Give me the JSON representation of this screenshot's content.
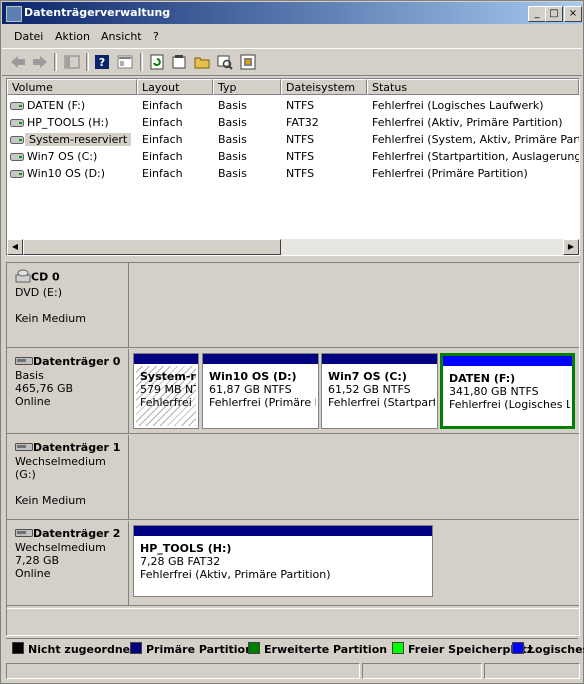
{
  "window": {
    "title": "Datenträgerverwaltung",
    "minimize": "_",
    "maximize": "□",
    "close": "×"
  },
  "menu": [
    {
      "label": "Datei",
      "accel": "D"
    },
    {
      "label": "Aktion",
      "accel": "k"
    },
    {
      "label": "Ansicht",
      "accel": "A"
    },
    {
      "label": "?",
      "accel": "?"
    }
  ],
  "toolbar": {
    "icons": [
      "back-icon",
      "forward-icon",
      "show-hide-tree-icon",
      "help-icon",
      "console-tree-icon",
      "refresh-icon",
      "properties-icon",
      "open-folder-icon",
      "rescan-icon",
      "settings-icon"
    ]
  },
  "volume_table": {
    "columns": [
      "Volume",
      "Layout",
      "Typ",
      "Dateisystem",
      "Status"
    ],
    "rows": [
      {
        "volume": "DATEN (F:)",
        "layout": "Einfach",
        "typ": "Basis",
        "fs": "NTFS",
        "status": "Fehlerfrei (Logisches Laufwerk)"
      },
      {
        "volume": "HP_TOOLS (H:)",
        "layout": "Einfach",
        "typ": "Basis",
        "fs": "FAT32",
        "status": "Fehlerfrei (Aktiv, Primäre Partition)"
      },
      {
        "volume": "System-reserviert",
        "layout": "Einfach",
        "typ": "Basis",
        "fs": "NTFS",
        "status": "Fehlerfrei (System, Aktiv, Primäre Partition)"
      },
      {
        "volume": "Win7 OS (C:)",
        "layout": "Einfach",
        "typ": "Basis",
        "fs": "NTFS",
        "status": "Fehlerfrei (Startpartition, Auslagerungsdatei"
      },
      {
        "volume": "Win10 OS (D:)",
        "layout": "Einfach",
        "typ": "Basis",
        "fs": "NTFS",
        "status": "Fehlerfrei (Primäre Partition)"
      }
    ],
    "selected_row": 2
  },
  "disks": [
    {
      "name": "CD 0",
      "line1": "DVD (E:)",
      "line2": "",
      "line3": "Kein Medium",
      "icon": "cd-drive-icon",
      "partitions": []
    },
    {
      "name": "Datenträger 0",
      "line1": "Basis",
      "line2": "465,76 GB",
      "line3": "Online",
      "icon": "hard-disk-icon",
      "partitions": [
        {
          "title": "System-r",
          "size": "579 MB NTF",
          "status": "Fehlerfrei (",
          "kind": "primary",
          "hatched": true
        },
        {
          "title": "Win10 OS  (D:)",
          "size": "61,87 GB NTFS",
          "status": "Fehlerfrei (Primäre Pa",
          "kind": "primary"
        },
        {
          "title": "Win7 OS  (C:)",
          "size": "61,52 GB NTFS",
          "status": "Fehlerfrei (Startpartit",
          "kind": "primary"
        },
        {
          "title": "DATEN  (F:)",
          "size": "341,80 GB NTFS",
          "status": "Fehlerfrei (Logisches Lau",
          "kind": "logical",
          "extended": true
        }
      ]
    },
    {
      "name": "Datenträger 1",
      "line1": "Wechselmedium (G:)",
      "line2": "",
      "line3": "Kein Medium",
      "icon": "removable-disk-icon",
      "partitions": []
    },
    {
      "name": "Datenträger 2",
      "line1": "Wechselmedium",
      "line2": "7,28 GB",
      "line3": "Online",
      "icon": "removable-disk-icon",
      "partitions": [
        {
          "title": "HP_TOOLS  (H:)",
          "size": "7,28 GB FAT32",
          "status": "Fehlerfrei (Aktiv, Primäre Partition)",
          "kind": "primary"
        }
      ]
    }
  ],
  "legend": [
    {
      "label": "Nicht zugeordnet",
      "color": "#000000"
    },
    {
      "label": "Primäre Partition",
      "color": "#000080"
    },
    {
      "label": "Erweiterte Partition",
      "color": "#008000"
    },
    {
      "label": "Freier Speicherplatz",
      "color": "#00ff00"
    },
    {
      "label": "Logisches",
      "color": "#0000ff"
    }
  ],
  "colors": {
    "primary": "#000080",
    "logical": "#0000ff",
    "extended": "#008000",
    "titlebar_start": "#0a246a",
    "selection": "#d4d0c8"
  }
}
